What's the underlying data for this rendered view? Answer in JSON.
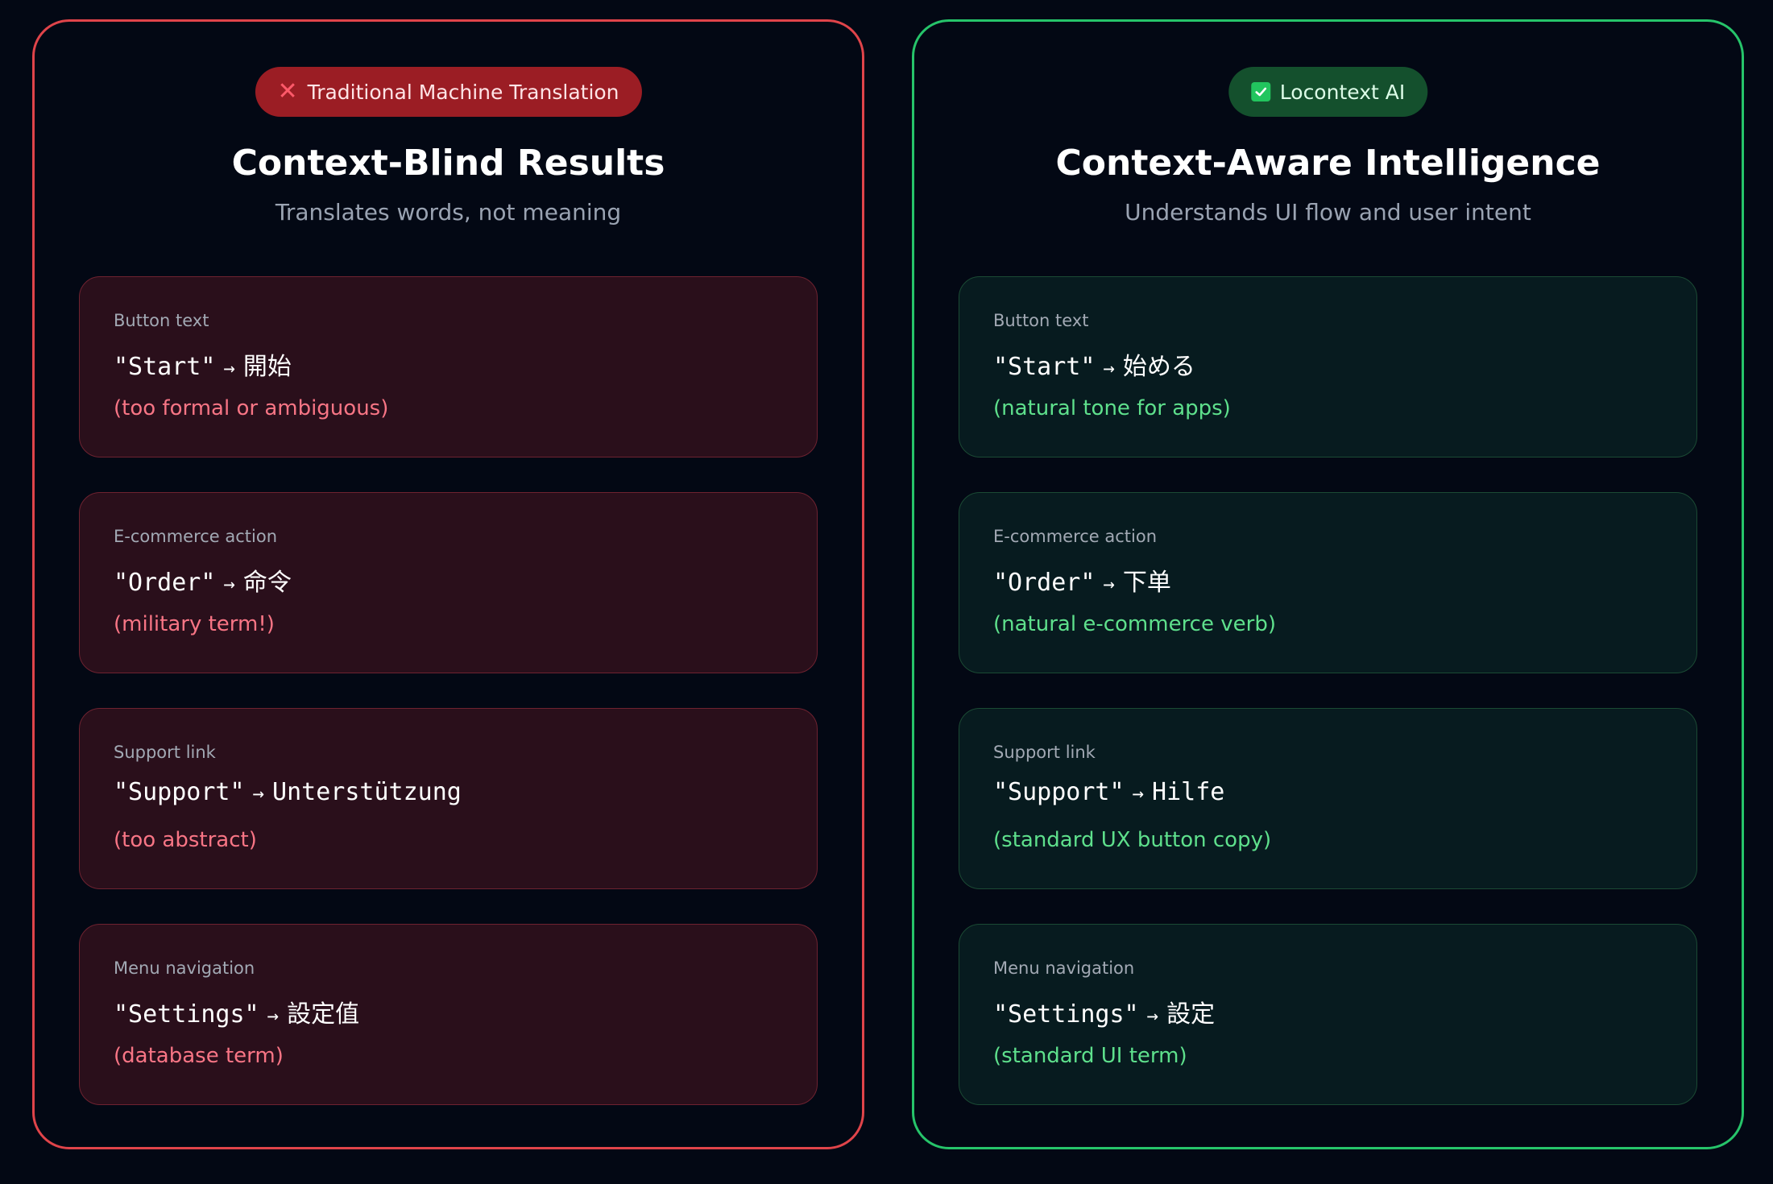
{
  "left_panel": {
    "badge_label": "Traditional Machine Translation",
    "title": "Context-Blind Results",
    "subtitle": "Translates words, not meaning",
    "cards": [
      {
        "label": "Button text",
        "source": "\"Start\"",
        "arrow": "→",
        "translation": "開始",
        "note": "(too formal or ambiguous)"
      },
      {
        "label": "E-commerce action",
        "source": "\"Order\"",
        "arrow": "→",
        "translation": "命令",
        "note": "(military term!)"
      },
      {
        "label": "Support link",
        "source": "\"Support\"",
        "arrow": "→",
        "translation": "Unterstützung",
        "note": "(too abstract)"
      },
      {
        "label": "Menu navigation",
        "source": "\"Settings\"",
        "arrow": "→",
        "translation": "設定值",
        "note": "(database term)"
      }
    ]
  },
  "right_panel": {
    "badge_label": "Locontext AI",
    "title": "Context-Aware Intelligence",
    "subtitle": "Understands UI flow and user intent",
    "cards": [
      {
        "label": "Button text",
        "source": "\"Start\"",
        "arrow": "→",
        "translation": "始める",
        "note": "(natural tone for apps)"
      },
      {
        "label": "E-commerce action",
        "source": "\"Order\"",
        "arrow": "→",
        "translation": "下单",
        "note": "(natural e-commerce verb)"
      },
      {
        "label": "Support link",
        "source": "\"Support\"",
        "arrow": "→",
        "translation": "Hilfe",
        "note": "(standard UX button copy)"
      },
      {
        "label": "Menu navigation",
        "source": "\"Settings\"",
        "arrow": "→",
        "translation": "設定",
        "note": "(standard UI term)"
      }
    ]
  },
  "icons": {
    "left_badge": "x-mark-icon",
    "right_badge": "checkbox-checked-icon"
  },
  "colors": {
    "background": "#030814",
    "negative_accent": "#e0444a",
    "positive_accent": "#26c46a",
    "negative_note": "#f87585",
    "positive_note": "#5ee08c"
  }
}
